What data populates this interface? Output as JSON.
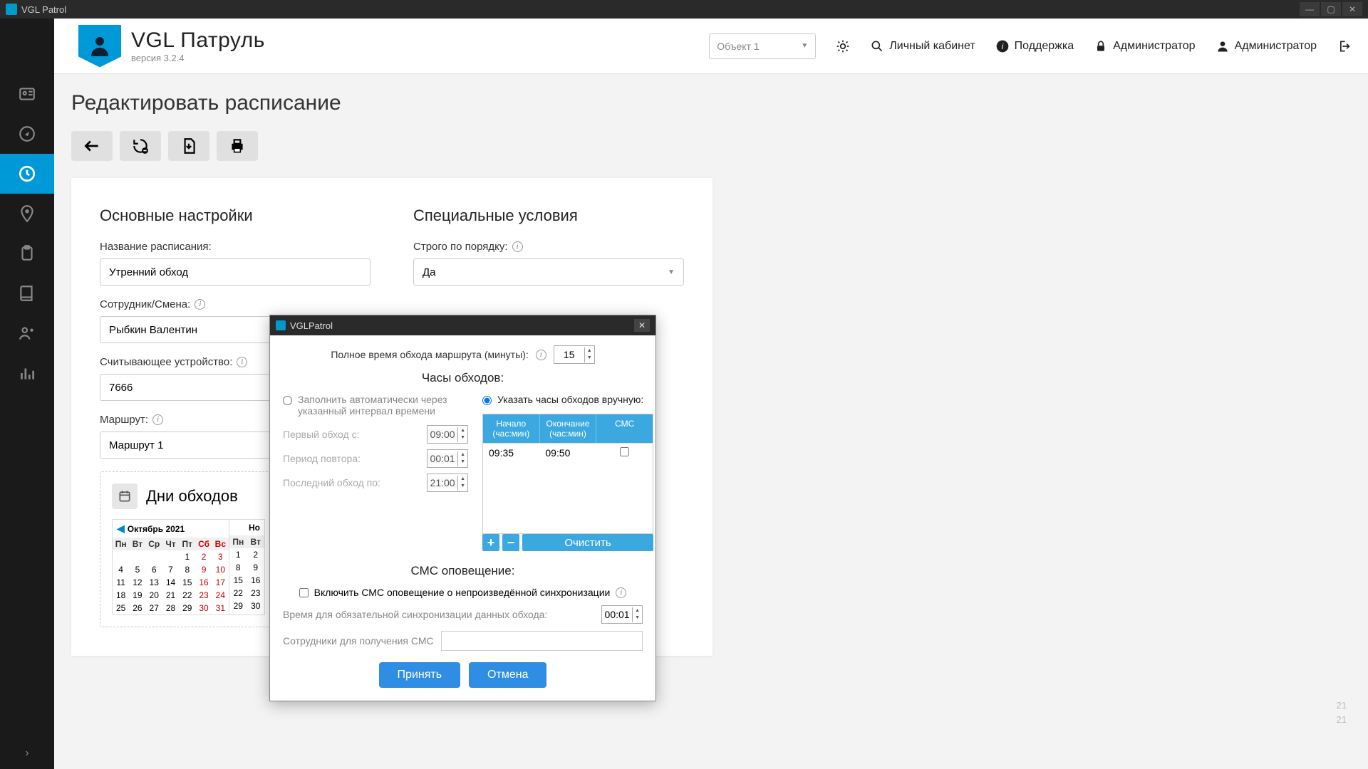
{
  "window": {
    "title": "VGL Patrol"
  },
  "app": {
    "name": "VGL Патруль",
    "version": "версия 3.2.4"
  },
  "header": {
    "object_selector": "Объект 1",
    "links": {
      "cabinet": "Личный кабинет",
      "support": "Поддержка",
      "admin": "Администратор",
      "user": "Администратор"
    }
  },
  "page": {
    "title": "Редактировать расписание",
    "section_main": "Основные настройки",
    "section_special": "Специальные условия",
    "labels": {
      "schedule_name": "Название расписания:",
      "employee": "Сотрудник/Смена:",
      "device": "Считывающее устройство:",
      "route": "Маршрут:",
      "strict_order": "Строго по порядку:",
      "days_title": "Дни обходов"
    },
    "values": {
      "schedule_name": "Утренний обход",
      "employee": "Рыбкин Валентин",
      "device": "7666",
      "route": "Маршрут 1",
      "strict_order": "Да"
    },
    "calendar": {
      "month_label": "Октябрь 2021",
      "next_hint": "Но",
      "dow": [
        "Пн",
        "Вт",
        "Ср",
        "Чт",
        "Пт",
        "Сб",
        "Вс"
      ],
      "rows": [
        [
          "",
          "",
          "",
          "",
          "1",
          "2",
          "3"
        ],
        [
          "4",
          "5",
          "6",
          "7",
          "8",
          "9",
          "10"
        ],
        [
          "11",
          "12",
          "13",
          "14",
          "15",
          "16",
          "17"
        ],
        [
          "18",
          "19",
          "20",
          "21",
          "22",
          "23",
          "24"
        ],
        [
          "25",
          "26",
          "27",
          "28",
          "29",
          "30",
          "31"
        ]
      ],
      "next_col": [
        "Пн",
        "1",
        "8",
        "15",
        "22",
        "29"
      ],
      "next_col2": [
        "Вт",
        "2",
        "9",
        "16",
        "23",
        "30"
      ]
    }
  },
  "modal": {
    "title": "VGLPatrol",
    "total_time_label": "Полное время обхода маршрута (минуты):",
    "total_time_value": "15",
    "hours_title": "Часы обходов:",
    "radio_auto": "Заполнить автоматически через указанный интервал времени",
    "radio_manual": "Указать часы обходов вручную:",
    "first_label": "Первый обход с:",
    "first_value": "09:00",
    "period_label": "Период повтора:",
    "period_value": "00:01",
    "last_label": "Последний обход по:",
    "last_value": "21:00",
    "table": {
      "col_start": "Начало (час:мин)",
      "col_end": "Окончание (час:мин)",
      "col_sms": "СМС",
      "row1_start": "09:35",
      "row1_end": "09:50"
    },
    "clear_btn": "Очистить",
    "sms_title": "СМС оповещение:",
    "sms_checkbox": "Включить СМС оповещение о непроизведённой синхронизации",
    "sync_time_label": "Время для обязательной синхронизации данных обхода:",
    "sync_time_value": "00:01",
    "sms_recipients_label": "Сотрудники для получения СМС",
    "accept": "Принять",
    "cancel": "Отмена"
  },
  "stray": {
    "t1": "21",
    "t2": "21"
  }
}
